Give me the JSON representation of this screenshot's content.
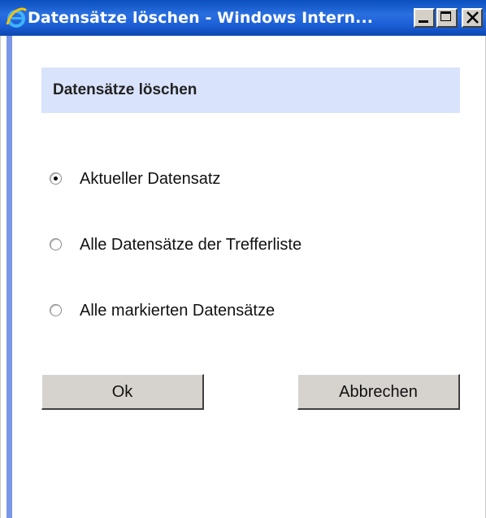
{
  "window": {
    "title": "Datensätze löschen - Windows Intern..."
  },
  "dialog": {
    "heading": "Datensätze löschen",
    "options": [
      {
        "label": "Aktueller Datensatz",
        "checked": true
      },
      {
        "label": "Alle Datensätze der Trefferliste",
        "checked": false
      },
      {
        "label": "Alle markierten Datensätze",
        "checked": false
      }
    ],
    "ok_label": "Ok",
    "cancel_label": "Abbrechen"
  },
  "colors": {
    "titlebar": "#1c5fd6",
    "header_panel": "#d9e3fc",
    "left_accent": "#7a96e6",
    "button_face": "#d6d3ce"
  },
  "icons": {
    "title_icon": "internet-explorer-icon"
  }
}
